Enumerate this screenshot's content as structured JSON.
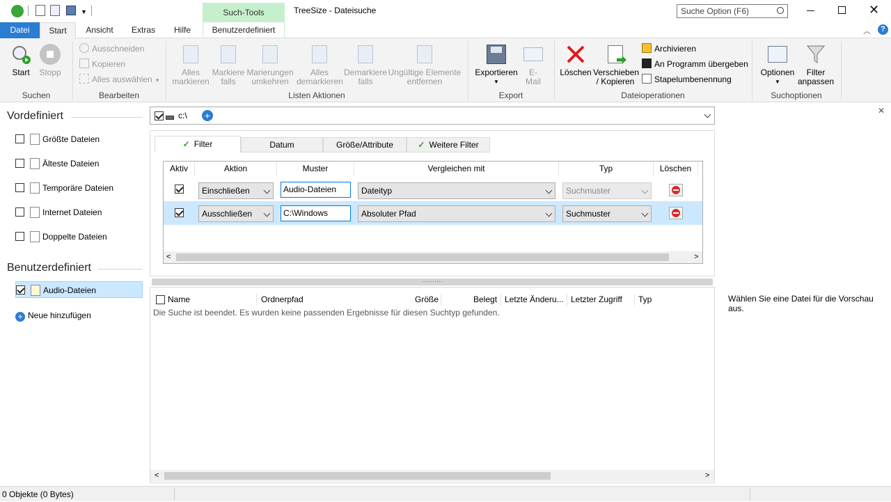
{
  "app": {
    "window_title": "TreeSize - Dateisuche",
    "context_tab": "Such-Tools",
    "search_placeholder": "Suche Option (F6)"
  },
  "tabs": {
    "datei": "Datei",
    "start": "Start",
    "ansicht": "Ansicht",
    "extras": "Extras",
    "hilfe": "Hilfe",
    "benutzerdefiniert": "Benutzerdefiniert"
  },
  "ribbon": {
    "suchen": {
      "label": "Suchen",
      "start": "Start",
      "stopp": "Stopp"
    },
    "bearbeiten": {
      "label": "Bearbeiten",
      "ausschneiden": "Ausschneiden",
      "kopieren": "Kopieren",
      "alles_auswaehlen": "Alles auswählen"
    },
    "listen": {
      "label": "Listen Aktionen",
      "alles_markieren_1": "Alles",
      "alles_markieren_2": "markieren",
      "markiere_falls_1": "Markiere",
      "markiere_falls_2": "falls",
      "markierungen_1": "Marierungen",
      "markierungen_2": "umkehren",
      "alles_demarkieren_1": "Alles",
      "alles_demarkieren_2": "demarkieren",
      "demarkiere_1": "Demarkiere",
      "demarkiere_2": "falls",
      "ungueltige_1": "Ungültige Elemente",
      "ungueltige_2": "entfernen"
    },
    "export": {
      "label": "Export",
      "exportieren": "Exportieren",
      "email_1": "E-",
      "email_2": "Mail"
    },
    "dateiop": {
      "label": "Dateioperationen",
      "loeschen": "Löschen",
      "verschieben_1": "Verschieben",
      "verschieben_2": "/ Kopieren",
      "archivieren": "Archivieren",
      "an_programm": "An Programm übergeben",
      "stapel": "Stapelumbenennung"
    },
    "suchoptionen": {
      "label": "Suchoptionen",
      "optionen": "Optionen",
      "filter_1": "Filter",
      "filter_2": "anpassen"
    }
  },
  "left": {
    "vordefiniert": "Vordefiniert",
    "items": [
      "Größte Dateien",
      "Älteste Dateien",
      "Temporäre Dateien",
      "Internet Dateien",
      "Doppelte Dateien"
    ],
    "benutzerdefiniert": "Benutzerdefiniert",
    "custom_item": "Audio-Dateien",
    "neue": "Neue hinzufügen"
  },
  "path": {
    "value": "c:\\"
  },
  "filter_tabs": [
    "Filter",
    "Datum",
    "Größe/Attribute",
    "Weitere Filter"
  ],
  "filter_cols": [
    "Aktiv",
    "Aktion",
    "Muster",
    "Vergleichen mit",
    "Typ",
    "Löschen"
  ],
  "filter_rows": [
    {
      "aktion": "Einschließen",
      "muster": "Audio-Dateien",
      "vergleich": "Dateityp",
      "typ": "Suchmuster"
    },
    {
      "aktion": "Ausschließen",
      "muster": "C:\\Windows",
      "vergleich": "Absoluter Pfad",
      "typ": "Suchmuster"
    }
  ],
  "results_cols": [
    "Name",
    "Ordnerpfad",
    "Größe",
    "Belegt",
    "Letzte Änderu...",
    "Letzter Zugriff",
    "Typ"
  ],
  "results_message": "Die Suche ist beendet. Es wurden keine passenden Ergebnisse für diesen Suchtyp gefunden.",
  "preview_message": "Wählen Sie eine Datei für die Vorschau aus.",
  "status": "0 Objekte (0 Bytes)",
  "colors": {
    "accent": "#2b7cd3",
    "context_green": "#c6efce",
    "selection": "#cce8ff"
  }
}
